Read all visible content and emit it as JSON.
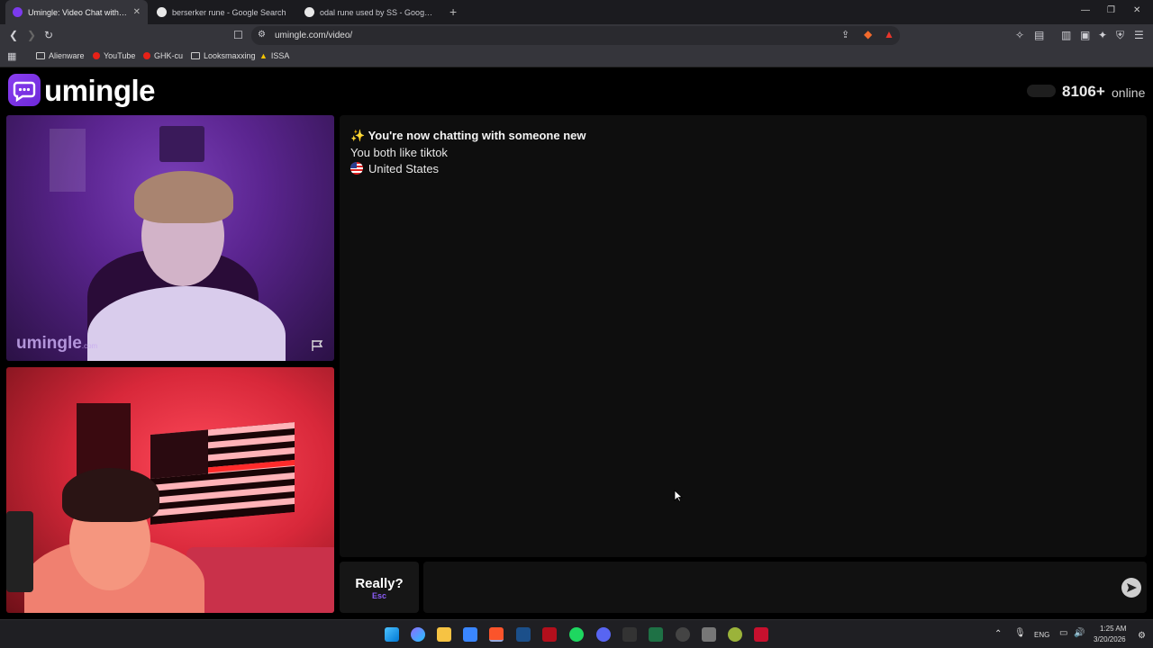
{
  "browser": {
    "tabs": [
      {
        "title": "Umingle: Video Chat with Stra",
        "active": true
      },
      {
        "title": "berserker rune - Google Search",
        "active": false
      },
      {
        "title": "odal rune used by SS - Google Search",
        "active": false
      }
    ],
    "url": "umingle.com/video/",
    "bookmarks": [
      {
        "label": "Alienware",
        "icon": "folder-icon"
      },
      {
        "label": "YouTube",
        "icon": "youtube-icon"
      },
      {
        "label": "GHK-cu",
        "icon": "youtube-icon"
      },
      {
        "label": "Looksmaxxing",
        "icon": "folder-icon"
      },
      {
        "label": "ISSA",
        "icon": "triangle-icon"
      }
    ]
  },
  "site": {
    "brand": "umingle",
    "online_count": "8106+",
    "online_label": "online",
    "accent_color": "#7c3aed"
  },
  "video": {
    "watermark": "umingle",
    "watermark_suffix": ".com"
  },
  "chat": {
    "status_line": "✨ You're now chatting with someone new",
    "interest_line": "You both like tiktok",
    "country": "United States"
  },
  "controls": {
    "skip_label": "Really?",
    "skip_hint": "Esc",
    "message_placeholder": ""
  },
  "taskbar": {
    "language": "ENG",
    "time": "1:25 AM",
    "date": "3/20/2026"
  }
}
